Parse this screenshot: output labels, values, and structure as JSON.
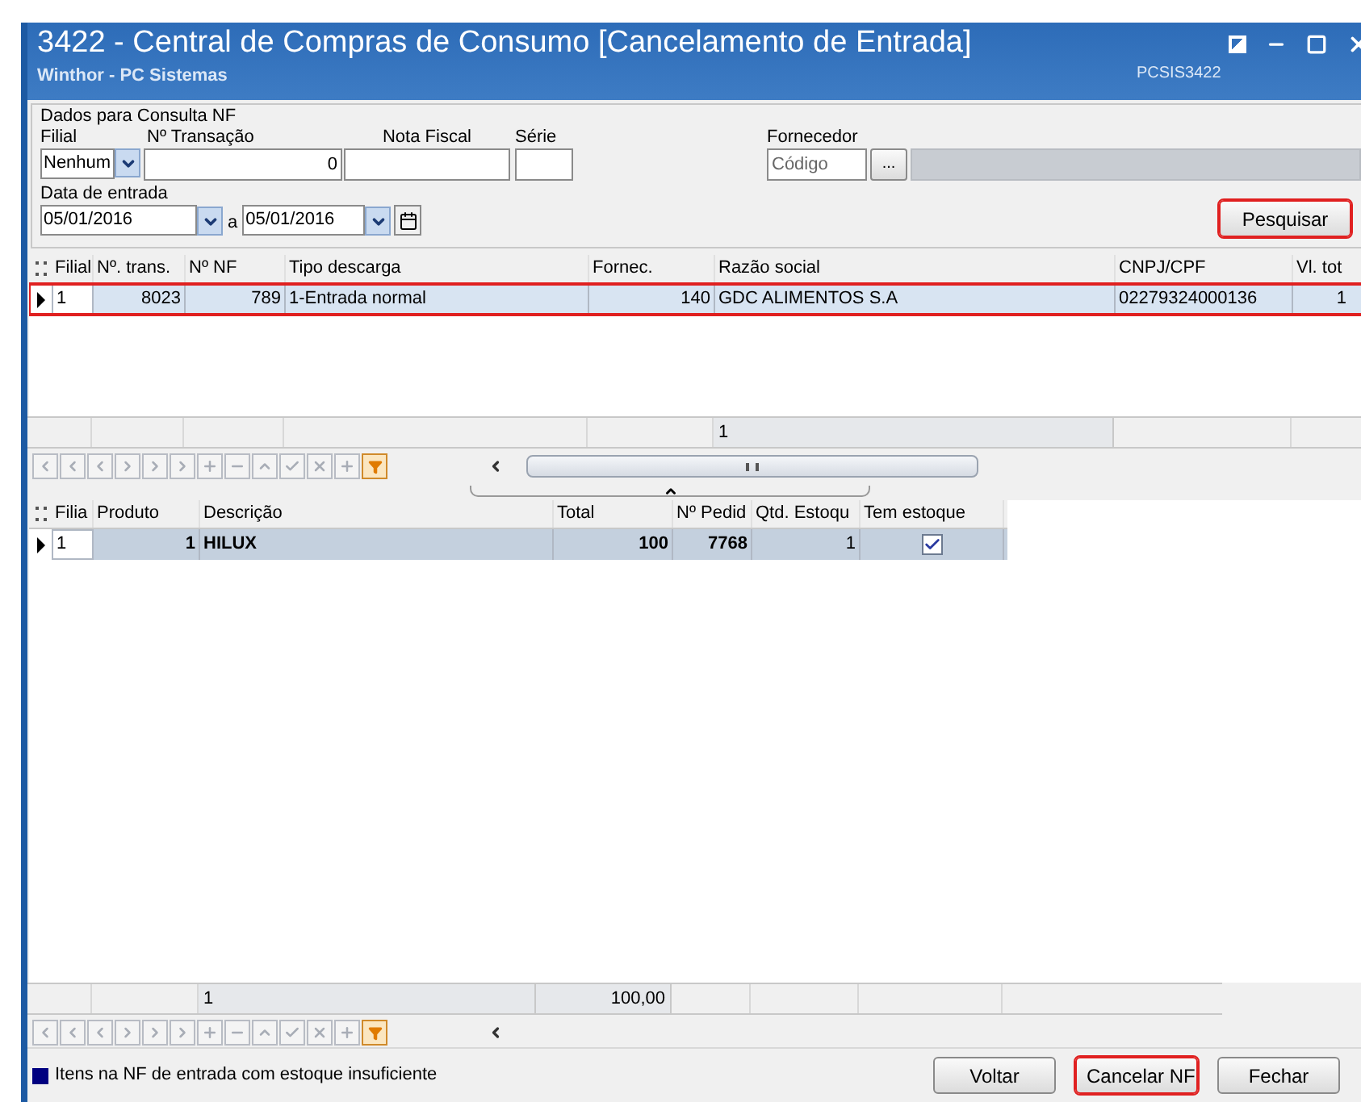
{
  "window": {
    "title": "3422 - Central de Compras de Consumo [Cancelamento de Entrada]",
    "subtitle": "Winthor - PC Sistemas",
    "code": "PCSIS3422"
  },
  "query": {
    "group_label": "Dados para Consulta NF",
    "filial": {
      "label": "Filial",
      "value": "Nenhum"
    },
    "transacao": {
      "label": "Nº Transação",
      "value": "0"
    },
    "nota": {
      "label": "Nota Fiscal"
    },
    "serie": {
      "label": "Série"
    },
    "fornecedor": {
      "label": "Fornecedor",
      "placeholder": "Código",
      "lookup": "..."
    },
    "data": {
      "label": "Data de entrada",
      "from": "05/01/2016",
      "separator": "a",
      "to": "05/01/2016"
    },
    "search_button": {
      "label": "Pesquisar",
      "highlighted": true
    }
  },
  "grid_nf": {
    "columns": [
      "Filial",
      "Nº. trans.",
      "Nº NF",
      "Tipo descarga",
      "Fornec.",
      "Razão social",
      "CNPJ/CPF",
      "Vl. tot"
    ],
    "rows": [
      {
        "cells": [
          "1",
          "8023",
          "789",
          "1-Entrada normal",
          "140",
          "GDC ALIMENTOS S.A",
          "02279324000136",
          "1"
        ],
        "selected": true,
        "highlighted": true
      }
    ],
    "footer": {
      "razao_social": "1"
    }
  },
  "grid_items": {
    "columns": [
      "Filia",
      "Produto",
      "Descrição",
      "Total",
      "Nº Pedid",
      "Qtd. Estoqu",
      "Tem estoque"
    ],
    "rows": [
      {
        "cells": [
          "1",
          "1",
          "HILUX",
          "100",
          "7768",
          "1"
        ],
        "tem_estoque": true,
        "selected": true
      }
    ],
    "footer": {
      "descricao": "1",
      "total": "100,00"
    }
  },
  "legend": {
    "color": "#000080",
    "text": "Itens na NF de entrada com estoque insuficiente"
  },
  "buttons": [
    {
      "label": "Voltar",
      "highlighted": false
    },
    {
      "label": "Cancelar NF",
      "highlighted": true
    },
    {
      "label": "Fechar",
      "highlighted": false
    }
  ]
}
